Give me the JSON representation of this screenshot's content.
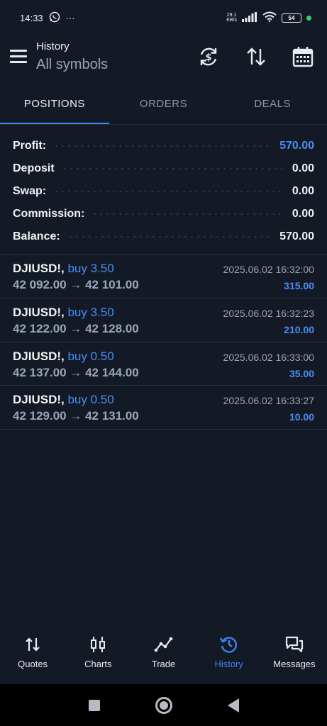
{
  "status_bar": {
    "time": "14:33",
    "dots": "···",
    "net_speed_value": "29.1",
    "net_speed_unit": "KB/s",
    "battery": "54"
  },
  "header": {
    "title": "History",
    "subtitle": "All symbols",
    "icons": [
      "currency-exchange-icon",
      "sort-icon",
      "calendar-icon"
    ]
  },
  "tabs": [
    {
      "label": "POSITIONS",
      "active": true
    },
    {
      "label": "ORDERS",
      "active": false
    },
    {
      "label": "DEALS",
      "active": false
    }
  ],
  "summary": {
    "profit_label": "Profit:",
    "profit_value": "570.00",
    "deposit_label": "Deposit",
    "deposit_value": "0.00",
    "swap_label": "Swap:",
    "swap_value": "0.00",
    "commission_label": "Commission:",
    "commission_value": "0.00",
    "balance_label": "Balance:",
    "balance_value": "570.00"
  },
  "deals": [
    {
      "symbol": "DJIUSD!,",
      "side": "buy 3.50",
      "prices": "42 092.00 → 42 101.00",
      "time": "2025.06.02 16:32:00",
      "profit": "315.00"
    },
    {
      "symbol": "DJIUSD!,",
      "side": "buy 3.50",
      "prices": "42 122.00 → 42 128.00",
      "time": "2025.06.02 16:32:23",
      "profit": "210.00"
    },
    {
      "symbol": "DJIUSD!,",
      "side": "buy 0.50",
      "prices": "42 137.00 → 42 144.00",
      "time": "2025.06.02 16:33:00",
      "profit": "35.00"
    },
    {
      "symbol": "DJIUSD!,",
      "side": "buy 0.50",
      "prices": "42 129.00 → 42 131.00",
      "time": "2025.06.02 16:33:27",
      "profit": "10.00"
    }
  ],
  "bottom_nav": [
    {
      "label": "Quotes",
      "icon": "quotes-icon",
      "active": false
    },
    {
      "label": "Charts",
      "icon": "candlestick-icon",
      "active": false
    },
    {
      "label": "Trade",
      "icon": "trade-icon",
      "active": false
    },
    {
      "label": "History",
      "icon": "history-icon",
      "active": true
    },
    {
      "label": "Messages",
      "icon": "messages-icon",
      "active": false
    }
  ],
  "colors": {
    "background": "#131a25",
    "accent": "#3c82f5",
    "profit_blue": "#4a8cf7",
    "muted_text": "#9aa6b8"
  }
}
